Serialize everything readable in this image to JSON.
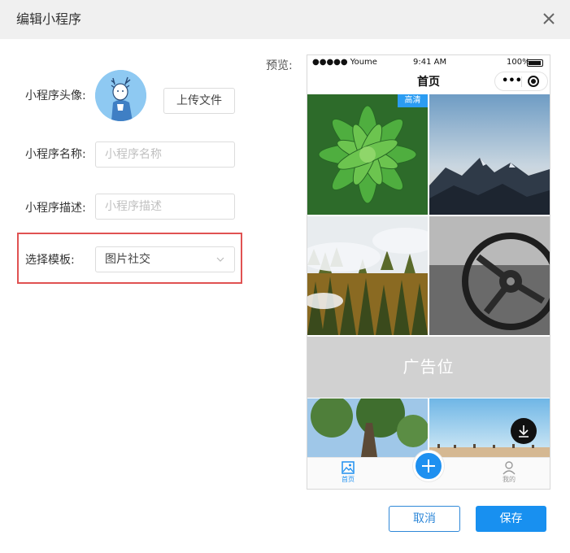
{
  "dialog": {
    "title": "编辑小程序",
    "close_icon": "close-icon"
  },
  "form": {
    "avatar_label": "小程序头像:",
    "upload_button": "上传文件",
    "name_label": "小程序名称:",
    "name_placeholder": "小程序名称",
    "desc_label": "小程序描述:",
    "desc_placeholder": "小程序描述",
    "template_label": "选择模板:",
    "template_value": "图片社交",
    "highlight_color": "#e05252"
  },
  "preview": {
    "label": "预览:",
    "status": {
      "carrier": "●●●●● Youme",
      "time": "9:41 AM",
      "battery": "100%"
    },
    "page_title": "首页",
    "capsule_more": "•••",
    "badge": "高清",
    "ad_text": "广告位",
    "tabs": [
      {
        "label": "首页",
        "icon": "image-icon",
        "active": true
      },
      {
        "label": "我的",
        "icon": "user-icon",
        "active": false
      }
    ],
    "accent": "#1e90f0"
  },
  "footer": {
    "cancel": "取消",
    "save": "保存"
  }
}
